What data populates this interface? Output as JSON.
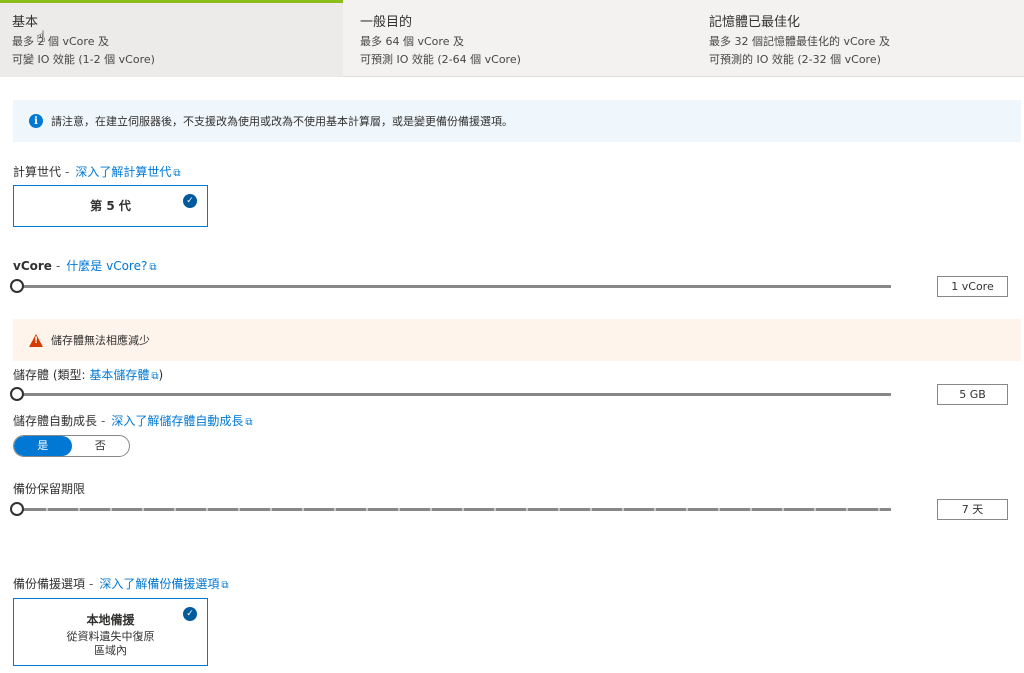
{
  "tiers": [
    {
      "title": "基本",
      "line1": "最多 2 個 vCore 及",
      "line2": "可變 IO 效能 (1-2 個 vCore)"
    },
    {
      "title": "一般目的",
      "line1": "最多 64 個 vCore 及",
      "line2": "可預測 IO 效能 (2-64 個 vCore)"
    },
    {
      "title": "記憶體已最佳化",
      "line1": "最多 32 個記憶體最佳化的 vCore 及",
      "line2": "可預測的 IO 效能 (2-32 個 vCore)"
    }
  ],
  "info_banner": {
    "icon": "info-icon",
    "text": "請注意，在建立伺服器後，不支援改為使用或改為不使用基本計算層，或是變更備份備援選項。"
  },
  "compute_gen": {
    "label": "計算世代",
    "sep": "-",
    "link": "深入了解計算世代",
    "card_title": "第 5 代"
  },
  "vcore": {
    "label": "vCore",
    "sep": "-",
    "link": "什麼是 vCore?",
    "value": "1 vCore"
  },
  "warn_banner": {
    "icon": "warning-icon",
    "text": "儲存體無法相應減少"
  },
  "storage": {
    "label": "儲存體 (類型:",
    "link": "基本儲存體",
    "close": ")",
    "value": "5 GB"
  },
  "autogrow": {
    "label": "儲存體自動成長",
    "sep": "-",
    "link": "深入了解儲存體自動成長",
    "on": "是",
    "off": "否"
  },
  "backup_retention": {
    "label": "備份保留期限",
    "value": "7 天"
  },
  "backup_redundancy": {
    "label": "備份備援選項",
    "sep": "-",
    "link": "深入了解備份備援選項",
    "card_title": "本地備援",
    "card_line1": "從資料遺失中復原",
    "card_line2": "區域內"
  },
  "colors": {
    "accent": "#0078d4",
    "selected_tier_bar": "#8cbd18",
    "warning": "#d83b01"
  }
}
